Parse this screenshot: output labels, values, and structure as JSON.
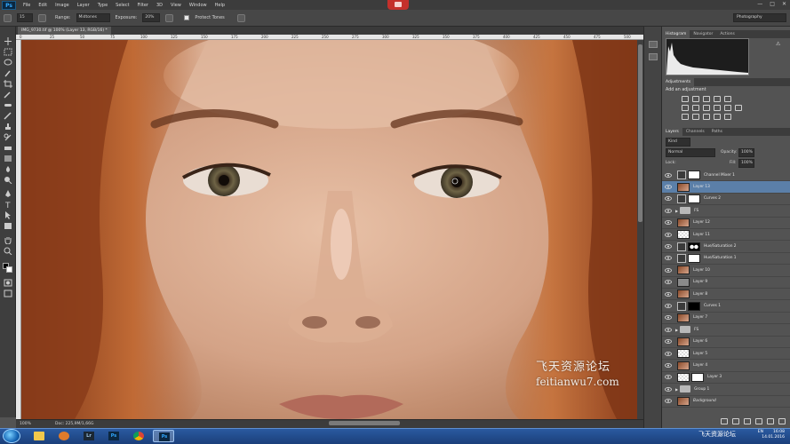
{
  "app": {
    "logo": "Ps"
  },
  "menu": [
    "File",
    "Edit",
    "Image",
    "Layer",
    "Type",
    "Select",
    "Filter",
    "3D",
    "View",
    "Window",
    "Help"
  ],
  "window_controls": [
    "—",
    "□",
    "✕"
  ],
  "options": {
    "brush_size": "15",
    "range_label": "Range:",
    "range_value": "Midtones",
    "exposure_label": "Exposure:",
    "exposure_value": "20%",
    "protect_label": "Protect Tones",
    "workspace": "Photography"
  },
  "document": {
    "tab_title": "IMG_9730.tif @ 100% (Layer 13, RGB/16) *",
    "ruler_marks": [
      "0",
      "25",
      "50",
      "75",
      "100",
      "125",
      "150",
      "175",
      "200",
      "225",
      "250",
      "275",
      "300",
      "325",
      "350",
      "375",
      "400",
      "425",
      "450",
      "475",
      "500"
    ],
    "zoom": "100%",
    "doc_size": "Doc: 225,9M/1,66G"
  },
  "panels": {
    "top_tabs": [
      "Histogram",
      "Navigator",
      "Actions"
    ],
    "adjustments": {
      "tabs": [
        "Adjustments"
      ],
      "subtitle": "Add an adjustment"
    },
    "layers_tabs": [
      "Layers",
      "Channels",
      "Paths"
    ],
    "filter_kind": "Kind",
    "blend_mode": "Normal",
    "opacity_label": "Opacity:",
    "opacity_value": "100%",
    "lock_label": "Lock:",
    "fill_label": "Fill:",
    "fill_value": "100%",
    "layers": [
      {
        "name": "Channel Mixer 1",
        "kind": "adj-mask",
        "thumb": "adj",
        "mask": "white"
      },
      {
        "name": "Layer 13",
        "kind": "pixel",
        "thumb": "face",
        "selected": true
      },
      {
        "name": "Curves 2",
        "kind": "adj-mask",
        "thumb": "adj",
        "mask": "white"
      },
      {
        "name": "FS",
        "kind": "folder"
      },
      {
        "name": "Layer 12",
        "kind": "pixel",
        "thumb": "face"
      },
      {
        "name": "Layer 11",
        "kind": "pixel",
        "thumb": "checker"
      },
      {
        "name": "Hue/Saturation 2",
        "kind": "adj-mask",
        "thumb": "adj",
        "mask": "black-spots"
      },
      {
        "name": "Hue/Saturation 1",
        "kind": "adj-mask",
        "thumb": "adj",
        "mask": "white"
      },
      {
        "name": "Layer 10",
        "kind": "pixel",
        "thumb": "face"
      },
      {
        "name": "Layer 9",
        "kind": "pixel",
        "thumb": "gray"
      },
      {
        "name": "Layer 8",
        "kind": "pixel",
        "thumb": "face"
      },
      {
        "name": "Curves 1",
        "kind": "adj-mask",
        "thumb": "adj",
        "mask": "black"
      },
      {
        "name": "Layer 7",
        "kind": "pixel",
        "thumb": "face"
      },
      {
        "name": "FS",
        "kind": "folder"
      },
      {
        "name": "Layer 6",
        "kind": "pixel",
        "thumb": "face"
      },
      {
        "name": "Layer 5",
        "kind": "pixel",
        "thumb": "checker"
      },
      {
        "name": "Layer 4",
        "kind": "pixel",
        "thumb": "face"
      },
      {
        "name": "Layer 3",
        "kind": "pixel-mask",
        "thumb": "checker",
        "mask": "white"
      },
      {
        "name": "Group 1",
        "kind": "folder"
      },
      {
        "name": "Background",
        "kind": "pixel",
        "thumb": "face",
        "italic": true
      }
    ]
  },
  "watermark": {
    "chinese": "飞天资源论坛",
    "url": "feitianwu7.com"
  },
  "taskbar": {
    "apps": [
      "explorer",
      "media",
      "Lr",
      "Ps",
      "chrome",
      "Ps"
    ],
    "tray_lang": "EN",
    "time": "16:08",
    "date": "14.01.2016",
    "logo_text": "飞天资源论坛"
  }
}
